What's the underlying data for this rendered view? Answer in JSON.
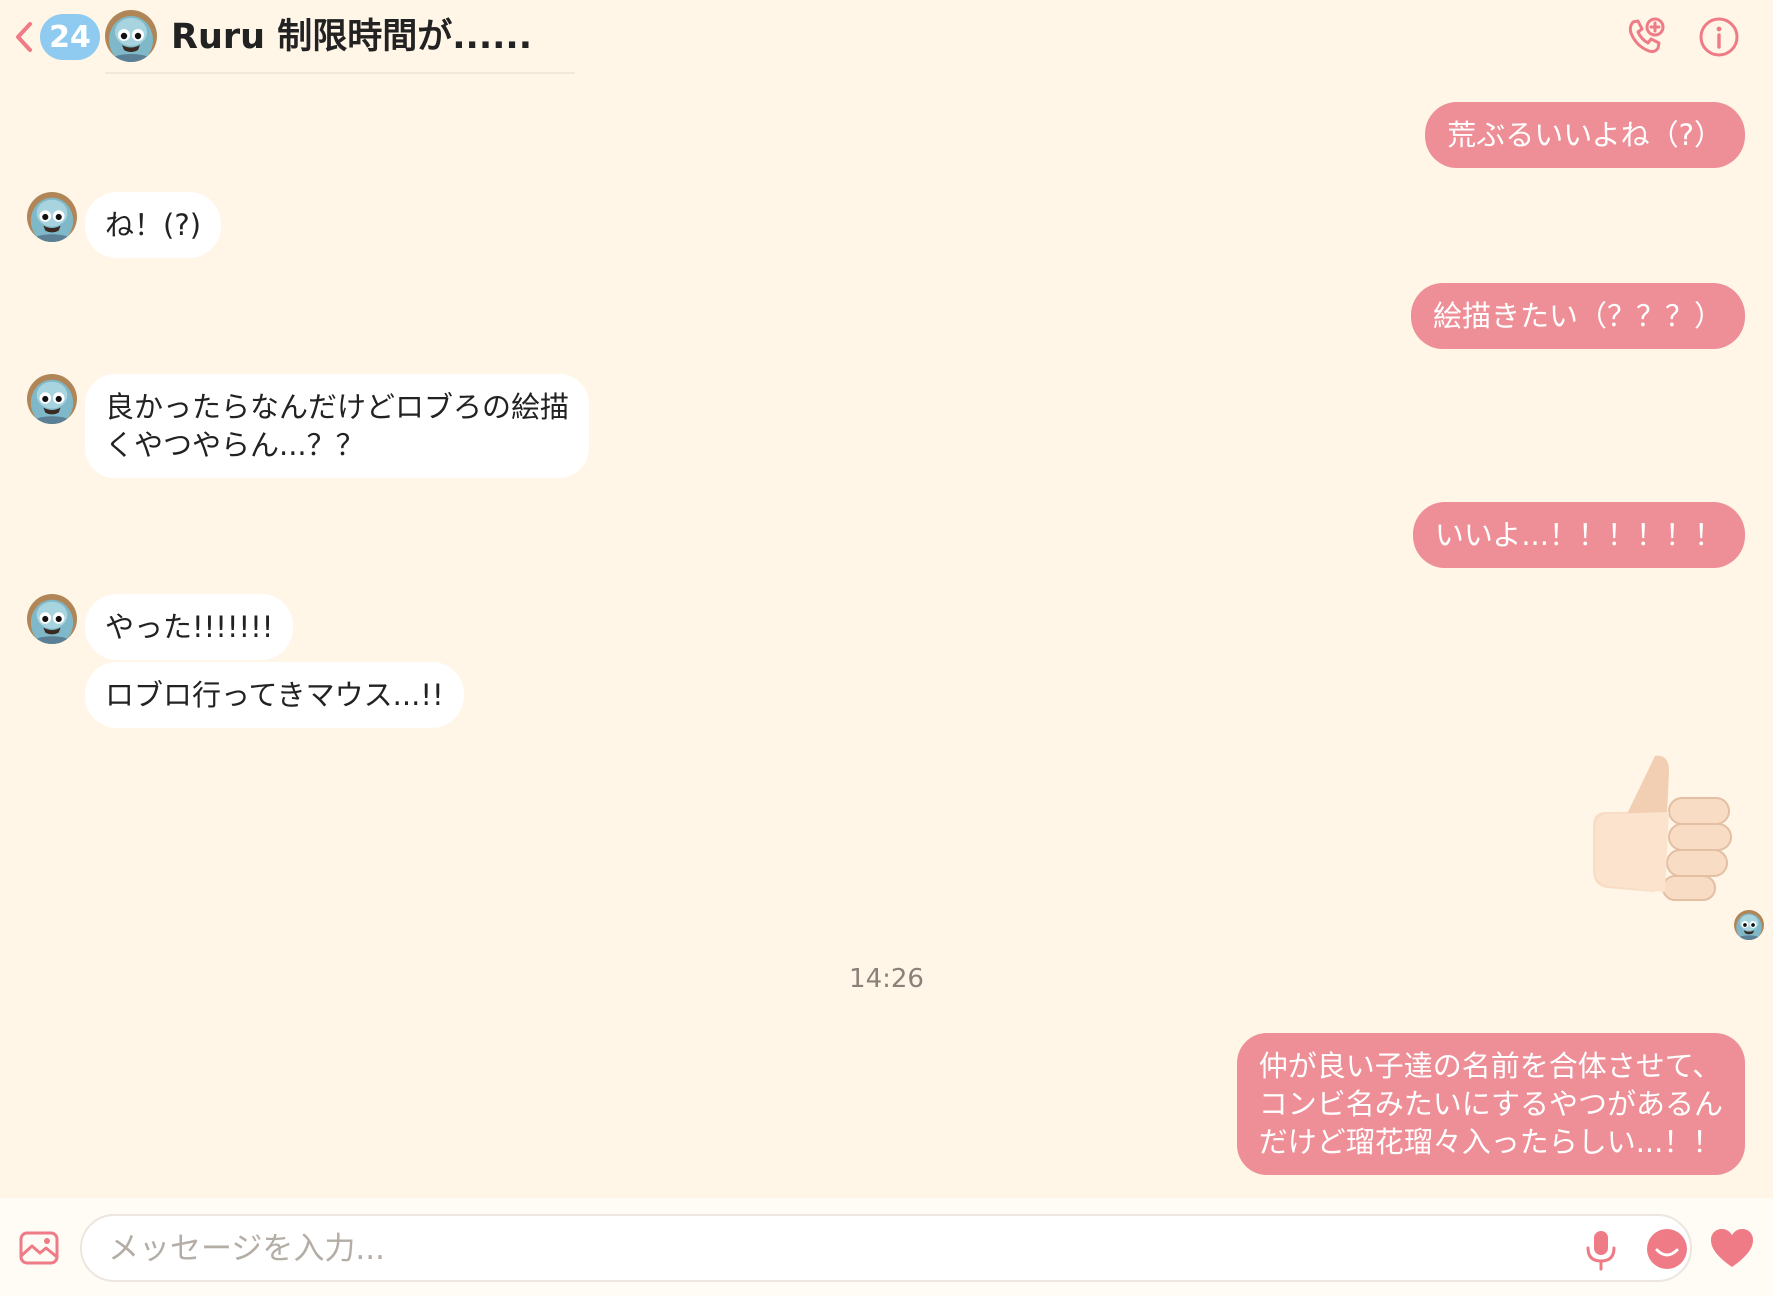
{
  "header": {
    "unread_count": "24",
    "title": "Ruru 制限時間が......",
    "icons": {
      "back": "chevron-left-icon",
      "call": "phone-add-icon",
      "info": "info-icon"
    }
  },
  "messages": [
    {
      "direction": "outgoing",
      "text": "荒ぶるいいよね（?）"
    },
    {
      "direction": "incoming",
      "text": "ね！(?)"
    },
    {
      "direction": "outgoing",
      "text": "絵描きたい（？？？）"
    },
    {
      "direction": "incoming",
      "text": "良かったらなんだけどロブろの絵描\nくやつやらん...？？"
    },
    {
      "direction": "outgoing",
      "text": "いいよ...！！！！！！"
    },
    {
      "direction": "incoming",
      "text": "やった!!!!!!!"
    },
    {
      "direction": "incoming",
      "text": "ロブロ行ってきマウス...!!"
    },
    {
      "direction": "outgoing",
      "sticker": "thumbs-up"
    },
    {
      "direction": "outgoing",
      "text": "仲が良い子達の名前を合体させて、\nコンビ名みたいにするやつがあるん\nだけど瑠花瑠々入ったらしい...！！"
    }
  ],
  "timestamp": "14:26",
  "composer": {
    "placeholder": "メッセージを入力...",
    "icons": {
      "gallery": "image-gallery-icon",
      "mic": "microphone-icon",
      "emoji": "emoji-icon",
      "like": "heart-icon"
    }
  },
  "colors": {
    "background": "#fff6e8",
    "outgoing_bubble": "#ee8e97",
    "incoming_bubble": "#ffffff",
    "badge": "#8fcbf0",
    "accent": "#ee7b86"
  }
}
